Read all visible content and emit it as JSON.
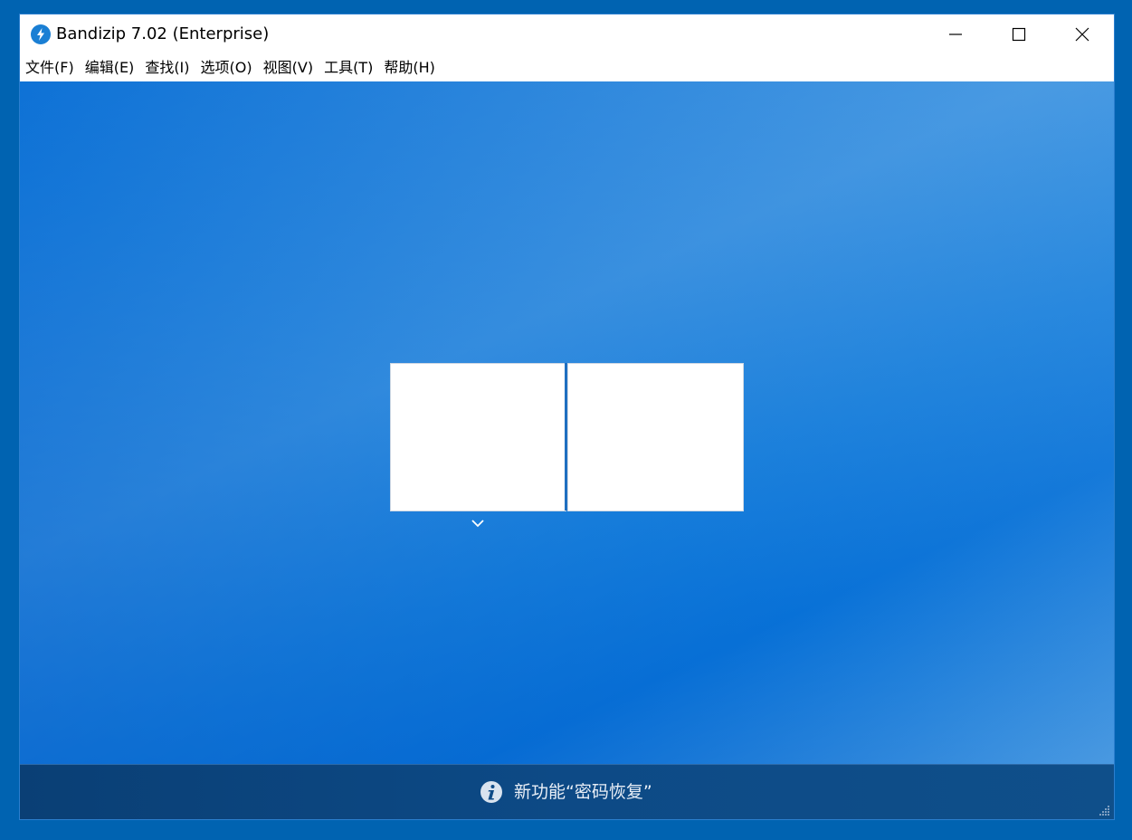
{
  "window": {
    "title": "Bandizip 7.02 (Enterprise)"
  },
  "menu": {
    "items": [
      {
        "label": "文件(F)",
        "name": "menu-file"
      },
      {
        "label": "编辑(E)",
        "name": "menu-edit"
      },
      {
        "label": "查找(I)",
        "name": "menu-find"
      },
      {
        "label": "选项(O)",
        "name": "menu-options"
      },
      {
        "label": "视图(V)",
        "name": "menu-view"
      },
      {
        "label": "工具(T)",
        "name": "menu-tools"
      },
      {
        "label": "帮助(H)",
        "name": "menu-help"
      }
    ]
  },
  "status": {
    "message": "新功能“密码恢复”"
  },
  "icons": {
    "app": "bandizip-logo-icon",
    "minimize": "minimize-icon",
    "maximize": "maximize-icon",
    "close": "close-icon",
    "dropdown": "chevron-down-icon",
    "info": "info-icon",
    "grip": "resize-grip-icon"
  },
  "colors": {
    "desktop": "#0063b1",
    "accent": "#1a7fd4",
    "statusbar": "#0d4a86"
  }
}
